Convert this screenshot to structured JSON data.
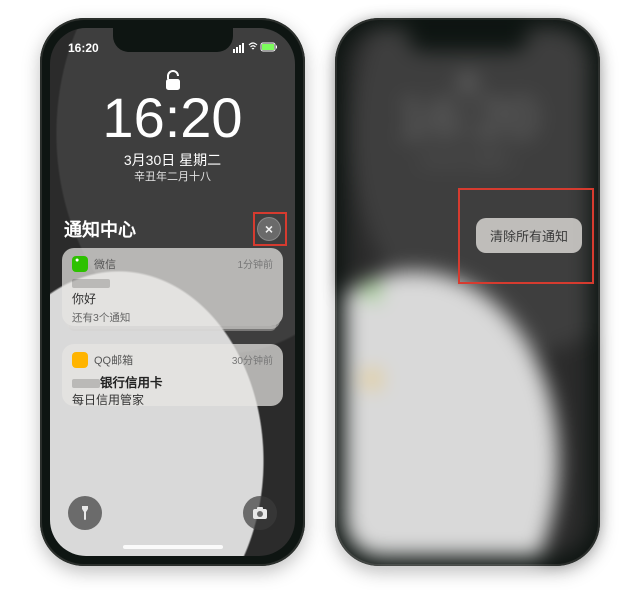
{
  "status": {
    "time": "16:20",
    "icons": "▪▫ ⌃ ⚡︎"
  },
  "lockscreen": {
    "clock": "16:20",
    "date": "3月30日 星期二",
    "lunar": "辛丑年二月十八"
  },
  "notificationCenter": {
    "title": "通知中心",
    "clear_glyph": "×"
  },
  "cards": [
    {
      "app": "微信",
      "time": "1分钟前",
      "title_prefix_redacted": true,
      "greeting": "你好",
      "more": "还有3个通知"
    },
    {
      "app": "QQ邮箱",
      "time": "30分钟前",
      "line1_prefix_redacted": true,
      "line1_suffix": "银行信用卡",
      "line2": "每日信用管家"
    }
  ],
  "clearAll": {
    "label": "清除所有通知"
  }
}
